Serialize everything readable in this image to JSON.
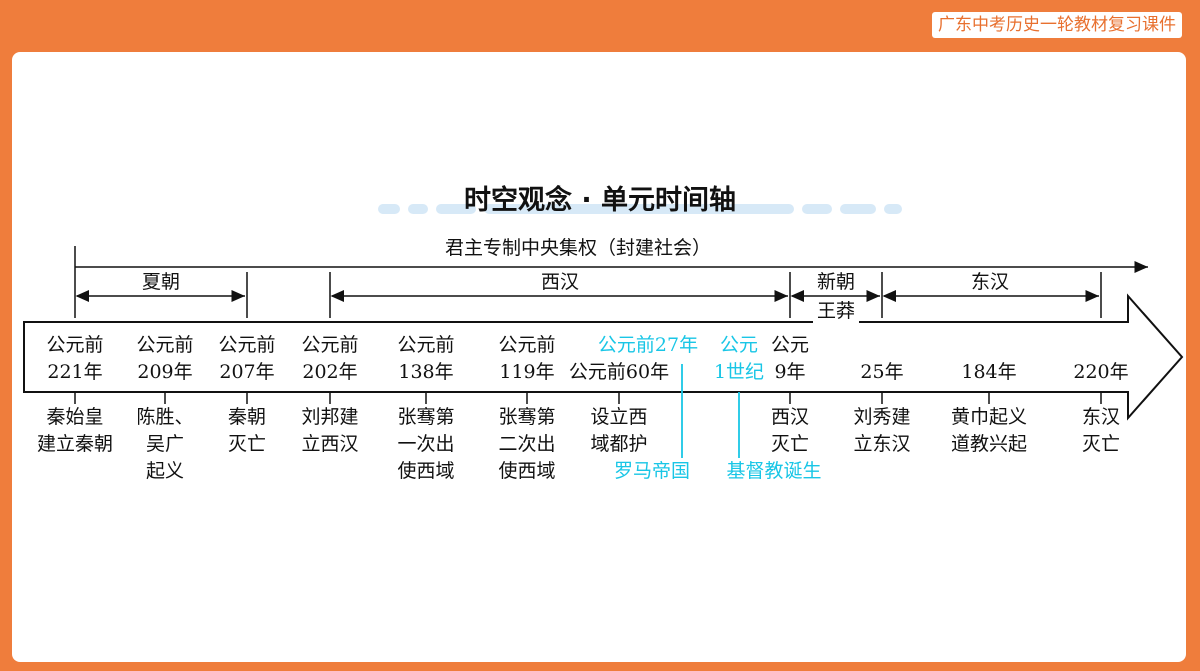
{
  "header": {
    "badge": "广东中考历史一轮教材复习课件"
  },
  "title": "时空观念 · 单元时间轴",
  "span_label": "君主专制中央集权（封建社会）",
  "periods": {
    "xia": "夏朝",
    "xihan": "西汉",
    "xinchao": "新朝",
    "wangmang": "王莽",
    "donghan": "东汉"
  },
  "dates": {
    "d221": "公元前\n221年",
    "d209": "公元前\n209年",
    "d207": "公元前\n207年",
    "d202": "公元前\n202年",
    "d138": "公元前\n138年",
    "d119": "公元前\n119年",
    "d60": "公元前60年",
    "d27": "公元前27年",
    "c1": "公元\n1世纪",
    "d9": "公元\n9年",
    "d25": "25年",
    "d184": "184年",
    "d220": "220年"
  },
  "events": {
    "e221": "秦始皇\n建立秦朝",
    "e209": "陈胜、\n吴广\n起义",
    "e207": "秦朝\n灭亡",
    "e202": "刘邦建\n立西汉",
    "e138": "张骞第\n一次出\n使西域",
    "e119": "张骞第\n二次出\n使西域",
    "e60": "设立西\n域都护",
    "e27": "罗马帝国",
    "c1": "基督教诞生",
    "e9": "西汉\n灭亡",
    "e25": "刘秀建\n立东汉",
    "e184": "黄巾起义\n道教兴起",
    "e220": "东汉\n灭亡"
  },
  "colors": {
    "border": "#ef7d3c",
    "world_events": "#19c6e6",
    "title_stripe": "#d7e9f7"
  }
}
